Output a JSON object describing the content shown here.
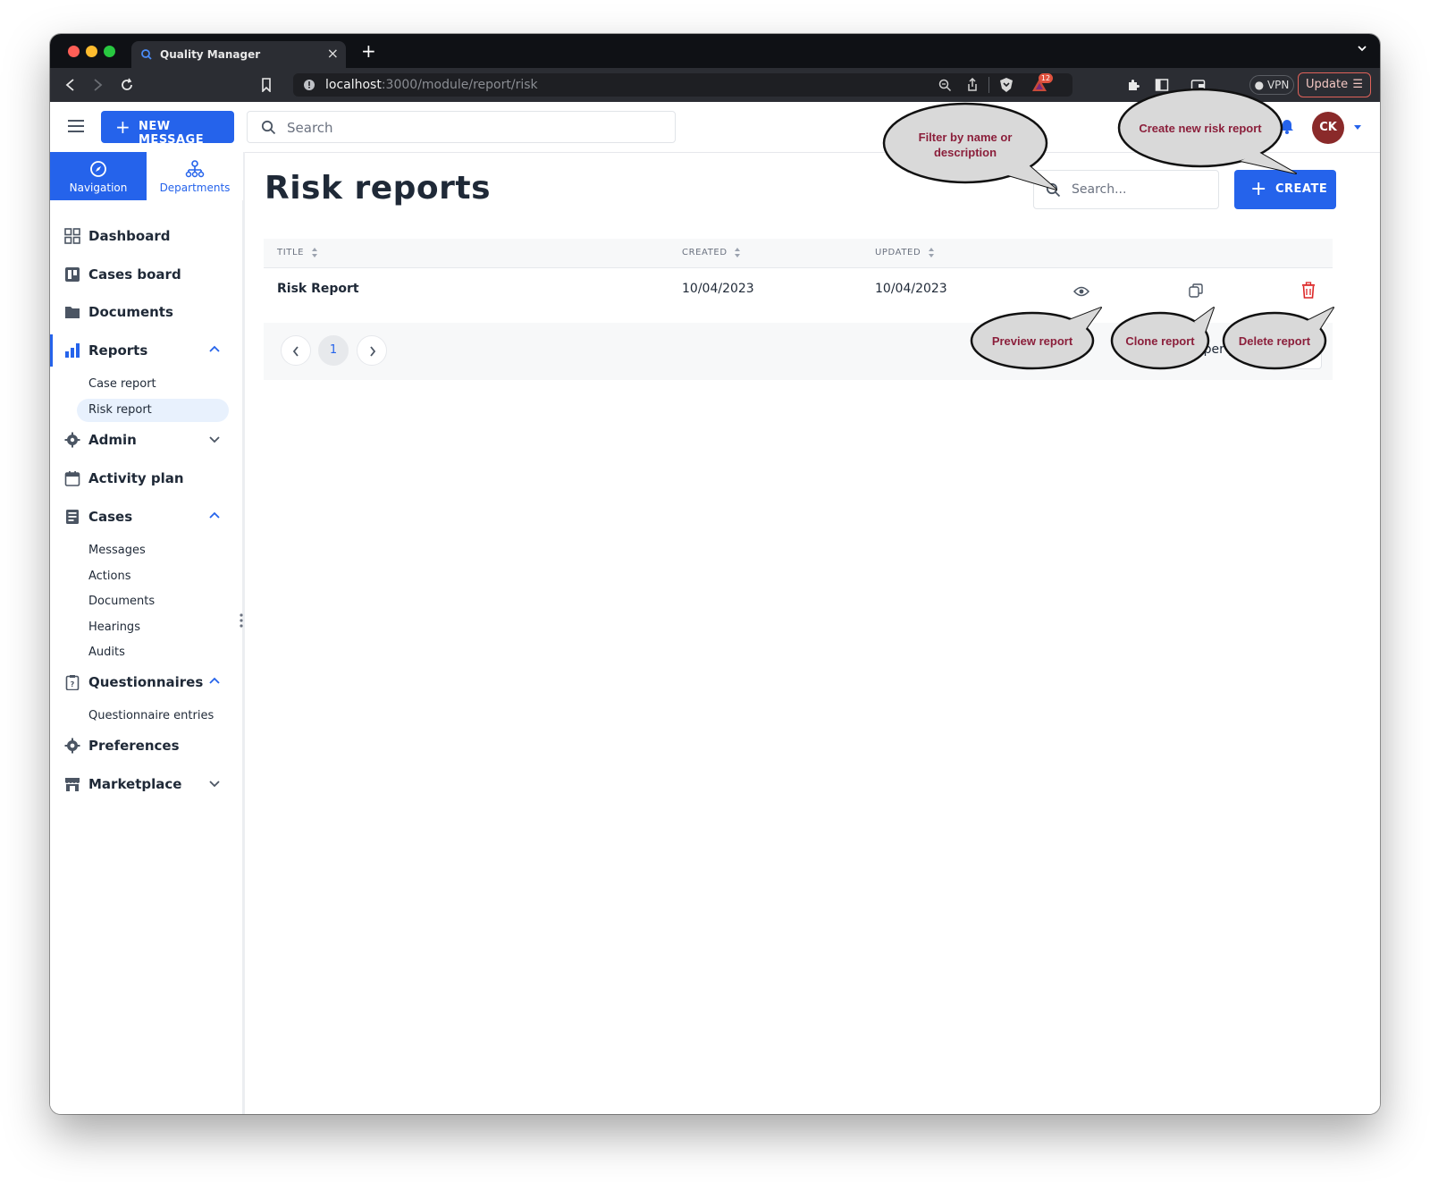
{
  "browser": {
    "tab_title": "Quality Manager",
    "url_host": "localhost",
    "url_path": ":3000/module/report/risk",
    "badge_count": "12",
    "vpn_label": "VPN",
    "update_label": "Update"
  },
  "appbar": {
    "new_message_label": "NEW MESSAGE",
    "search_placeholder": "Search",
    "avatar_initials": "CK"
  },
  "sidebar": {
    "tabs": [
      {
        "label": "Navigation",
        "active": true
      },
      {
        "label": "Departments",
        "active": false
      }
    ],
    "items": [
      {
        "label": "Dashboard",
        "icon": "dashboard-icon"
      },
      {
        "label": "Cases board",
        "icon": "board-icon"
      },
      {
        "label": "Documents",
        "icon": "folder-icon"
      },
      {
        "label": "Reports",
        "icon": "bar-chart-icon",
        "expanded": true,
        "active": true,
        "children": [
          {
            "label": "Case report"
          },
          {
            "label": "Risk report",
            "active": true
          }
        ]
      },
      {
        "label": "Admin",
        "icon": "admin-gear-icon",
        "expanded": false
      },
      {
        "label": "Activity plan",
        "icon": "calendar-icon"
      },
      {
        "label": "Cases",
        "icon": "cases-icon",
        "expanded": true,
        "children": [
          {
            "label": "Messages"
          },
          {
            "label": "Actions"
          },
          {
            "label": "Documents"
          },
          {
            "label": "Hearings"
          },
          {
            "label": "Audits"
          }
        ]
      },
      {
        "label": "Questionnaires",
        "icon": "clipboard-icon",
        "expanded": true,
        "children": [
          {
            "label": "Questionnaire entries"
          }
        ]
      },
      {
        "label": "Preferences",
        "icon": "gear-icon"
      },
      {
        "label": "Marketplace",
        "icon": "store-icon",
        "expanded": false
      }
    ]
  },
  "main": {
    "title": "Risk reports",
    "filter_placeholder": "Search...",
    "create_label": "CREATE",
    "columns": [
      "TITLE",
      "CREATED",
      "UPDATED"
    ],
    "rows": [
      {
        "title": "Risk Report",
        "created": "10/04/2023",
        "updated": "10/04/2023"
      }
    ],
    "pagination": {
      "current_page": "1",
      "items_per_page_label": "Items per page"
    }
  },
  "callouts": {
    "filter": "Filter by name or description",
    "create": "Create new risk report",
    "preview": "Preview report",
    "clone": "Clone report",
    "delete": "Delete report"
  },
  "colors": {
    "primary": "#2563eb",
    "danger": "#dc2626",
    "callout_text": "#8b1f3b",
    "callout_fill": "#d9d9d9",
    "avatar": "#8a2a2a"
  }
}
